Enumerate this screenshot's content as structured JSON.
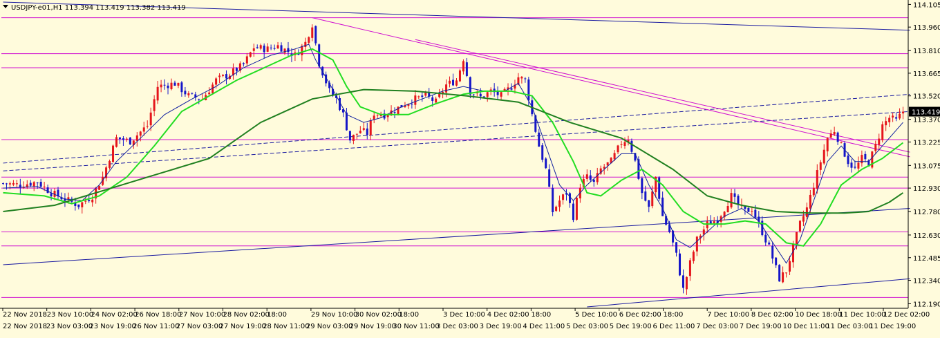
{
  "header": {
    "title": "USDJPY-e01,H1  113.394 113.419 113.382 113.419",
    "menu_icon": "triangle-down-icon"
  },
  "colors": {
    "background": "#fffbdc",
    "bull": "#e5151b",
    "bear": "#1515c8",
    "ma_fast": "#1020a0",
    "ma_mid": "#22dd22",
    "ma_slow": "#208020",
    "level": "#d010d0",
    "channel": "#1a1aa0",
    "price_tag_bg": "#000000",
    "price_tag_fg": "#ffffff"
  },
  "chart_data": {
    "type": "candlestick",
    "symbol": "USDJPY-e01",
    "timeframe": "H1",
    "ylim": [
      112.17,
      114.12
    ],
    "grid": false,
    "current_price": "113.419",
    "y_ticks": [
      "114.105",
      "113.960",
      "113.810",
      "113.665",
      "113.520",
      "113.370",
      "113.225",
      "113.075",
      "112.930",
      "112.780",
      "112.630",
      "112.485",
      "112.340",
      "112.190"
    ],
    "x_ticks_top": [
      "22 Nov 2018",
      "23 Nov 10:00",
      "24 Nov 02:00",
      "26 Nov 18:00",
      "27 Nov 10:00",
      "28 Nov 02:00",
      "18:00",
      "29 Nov 10:00",
      "30 Nov 02:00",
      "18:00",
      "3 Dec 10:00",
      "4 Dec 02:00",
      "18:00",
      "5 Dec 10:00",
      "6 Dec 02:00",
      "18:00",
      "7 Dec 10:00",
      "8 Dec 02:00",
      "10 Dec 18:00",
      "11 Dec 10:00",
      "12 Dec 02:00"
    ],
    "x_ticks_bottom": [
      "22 Nov 2018",
      "23 Nov 03:00",
      "23 Nov 19:00",
      "26 Nov 11:00",
      "27 Nov 03:00",
      "27 Nov 19:00",
      "28 Nov 11:00",
      "29 Nov 03:00",
      "29 Nov 19:00",
      "30 Nov 11:00",
      "3 Dec 03:00",
      "3 Dec 19:00",
      "4 Dec 11:00",
      "5 Dec 03:00",
      "5 Dec 19:00",
      "6 Dec 11:00",
      "7 Dec 03:00",
      "7 Dec 19:00",
      "10 Dec 11:00",
      "11 Dec 03:00",
      "11 Dec 19:00"
    ],
    "horizontal_levels": [
      114.02,
      113.79,
      113.7,
      113.24,
      113.0,
      112.93,
      112.65,
      112.56,
      112.23
    ],
    "close_path": [
      [
        0,
        112.96
      ],
      [
        5,
        112.95
      ],
      [
        10,
        112.97
      ],
      [
        14,
        112.9
      ],
      [
        18,
        112.86
      ],
      [
        22,
        112.82
      ],
      [
        26,
        112.88
      ],
      [
        29,
        113.0
      ],
      [
        33,
        113.25
      ],
      [
        37,
        113.23
      ],
      [
        42,
        113.33
      ],
      [
        45,
        113.58
      ],
      [
        50,
        113.6
      ],
      [
        54,
        113.52
      ],
      [
        58,
        113.5
      ],
      [
        62,
        113.62
      ],
      [
        66,
        113.66
      ],
      [
        70,
        113.72
      ],
      [
        73,
        113.83
      ],
      [
        77,
        113.82
      ],
      [
        80,
        113.84
      ],
      [
        85,
        113.78
      ],
      [
        88,
        113.86
      ],
      [
        90,
        113.98
      ],
      [
        92,
        113.73
      ],
      [
        95,
        113.55
      ],
      [
        97,
        113.5
      ],
      [
        99,
        113.4
      ],
      [
        101,
        113.24
      ],
      [
        104,
        113.3
      ],
      [
        106,
        113.28
      ],
      [
        108,
        113.41
      ],
      [
        111,
        113.4
      ],
      [
        114,
        113.43
      ],
      [
        117,
        113.47
      ],
      [
        120,
        113.5
      ],
      [
        123,
        113.52
      ],
      [
        126,
        113.48
      ],
      [
        129,
        113.59
      ],
      [
        132,
        113.62
      ],
      [
        134,
        113.76
      ],
      [
        136,
        113.55
      ],
      [
        139,
        113.51
      ],
      [
        142,
        113.55
      ],
      [
        145,
        113.52
      ],
      [
        148,
        113.58
      ],
      [
        150,
        113.64
      ],
      [
        152,
        113.62
      ],
      [
        154,
        113.4
      ],
      [
        156,
        113.2
      ],
      [
        158,
        113.05
      ],
      [
        160,
        112.78
      ],
      [
        162,
        112.85
      ],
      [
        164,
        112.9
      ],
      [
        166,
        112.75
      ],
      [
        168,
        112.95
      ],
      [
        170,
        113.0
      ],
      [
        172,
        112.96
      ],
      [
        174,
        113.05
      ],
      [
        177,
        113.1
      ],
      [
        180,
        113.22
      ],
      [
        182,
        113.25
      ],
      [
        184,
        113.1
      ],
      [
        186,
        112.9
      ],
      [
        188,
        112.8
      ],
      [
        190,
        113.0
      ],
      [
        192,
        112.75
      ],
      [
        194,
        112.65
      ],
      [
        196,
        112.5
      ],
      [
        198,
        112.28
      ],
      [
        200,
        112.45
      ],
      [
        202,
        112.6
      ],
      [
        205,
        112.7
      ],
      [
        208,
        112.73
      ],
      [
        210,
        112.8
      ],
      [
        212,
        112.88
      ],
      [
        214,
        112.82
      ],
      [
        216,
        112.78
      ],
      [
        218,
        112.8
      ],
      [
        221,
        112.65
      ],
      [
        223,
        112.55
      ],
      [
        226,
        112.35
      ],
      [
        228,
        112.4
      ],
      [
        230,
        112.55
      ],
      [
        232,
        112.7
      ],
      [
        234,
        112.8
      ],
      [
        236,
        112.95
      ],
      [
        238,
        113.1
      ],
      [
        240,
        113.25
      ],
      [
        242,
        113.3
      ],
      [
        244,
        113.2
      ],
      [
        246,
        113.1
      ],
      [
        248,
        113.05
      ],
      [
        250,
        113.12
      ],
      [
        252,
        113.09
      ],
      [
        254,
        113.2
      ],
      [
        256,
        113.33
      ],
      [
        258,
        113.38
      ],
      [
        260,
        113.36
      ],
      [
        262,
        113.42
      ]
    ],
    "moving_averages": [
      {
        "name": "fast",
        "points": [
          [
            0,
            112.93
          ],
          [
            10,
            112.94
          ],
          [
            18,
            112.86
          ],
          [
            23,
            112.85
          ],
          [
            28,
            112.95
          ],
          [
            33,
            113.1
          ],
          [
            40,
            113.25
          ],
          [
            47,
            113.4
          ],
          [
            55,
            113.5
          ],
          [
            62,
            113.58
          ],
          [
            70,
            113.7
          ],
          [
            78,
            113.78
          ],
          [
            85,
            113.82
          ],
          [
            89,
            113.85
          ],
          [
            91,
            113.75
          ],
          [
            95,
            113.6
          ],
          [
            100,
            113.4
          ],
          [
            105,
            113.35
          ],
          [
            110,
            113.38
          ],
          [
            116,
            113.45
          ],
          [
            122,
            113.5
          ],
          [
            128,
            113.55
          ],
          [
            134,
            113.58
          ],
          [
            140,
            113.55
          ],
          [
            146,
            113.55
          ],
          [
            150,
            113.6
          ],
          [
            154,
            113.45
          ],
          [
            158,
            113.2
          ],
          [
            162,
            112.95
          ],
          [
            166,
            112.85
          ],
          [
            170,
            112.95
          ],
          [
            175,
            113.05
          ],
          [
            180,
            113.15
          ],
          [
            184,
            113.15
          ],
          [
            188,
            112.95
          ],
          [
            192,
            112.8
          ],
          [
            196,
            112.6
          ],
          [
            200,
            112.55
          ],
          [
            205,
            112.65
          ],
          [
            210,
            112.75
          ],
          [
            215,
            112.8
          ],
          [
            220,
            112.72
          ],
          [
            225,
            112.55
          ],
          [
            228,
            112.45
          ],
          [
            232,
            112.6
          ],
          [
            236,
            112.85
          ],
          [
            240,
            113.1
          ],
          [
            244,
            113.2
          ],
          [
            248,
            113.1
          ],
          [
            252,
            113.1
          ],
          [
            256,
            113.2
          ],
          [
            260,
            113.3
          ],
          [
            262,
            113.35
          ]
        ]
      },
      {
        "name": "mid",
        "points": [
          [
            0,
            112.9
          ],
          [
            12,
            112.88
          ],
          [
            20,
            112.83
          ],
          [
            28,
            112.88
          ],
          [
            36,
            113.0
          ],
          [
            44,
            113.2
          ],
          [
            52,
            113.42
          ],
          [
            60,
            113.52
          ],
          [
            68,
            113.62
          ],
          [
            76,
            113.7
          ],
          [
            84,
            113.78
          ],
          [
            90,
            113.82
          ],
          [
            96,
            113.75
          ],
          [
            100,
            113.58
          ],
          [
            104,
            113.45
          ],
          [
            110,
            113.4
          ],
          [
            118,
            113.4
          ],
          [
            126,
            113.47
          ],
          [
            134,
            113.53
          ],
          [
            140,
            113.55
          ],
          [
            148,
            113.55
          ],
          [
            154,
            113.52
          ],
          [
            160,
            113.35
          ],
          [
            166,
            113.1
          ],
          [
            170,
            112.9
          ],
          [
            174,
            112.88
          ],
          [
            180,
            112.98
          ],
          [
            186,
            113.05
          ],
          [
            192,
            112.95
          ],
          [
            198,
            112.78
          ],
          [
            204,
            112.7
          ],
          [
            210,
            112.7
          ],
          [
            216,
            112.72
          ],
          [
            222,
            112.7
          ],
          [
            228,
            112.58
          ],
          [
            233,
            112.56
          ],
          [
            238,
            112.7
          ],
          [
            244,
            112.95
          ],
          [
            250,
            113.05
          ],
          [
            256,
            113.12
          ],
          [
            262,
            113.22
          ]
        ]
      },
      {
        "name": "slow",
        "points": [
          [
            0,
            112.78
          ],
          [
            15,
            112.82
          ],
          [
            30,
            112.92
          ],
          [
            45,
            113.02
          ],
          [
            60,
            113.12
          ],
          [
            75,
            113.35
          ],
          [
            90,
            113.5
          ],
          [
            105,
            113.56
          ],
          [
            120,
            113.55
          ],
          [
            135,
            113.52
          ],
          [
            150,
            113.48
          ],
          [
            165,
            113.35
          ],
          [
            180,
            113.25
          ],
          [
            195,
            113.05
          ],
          [
            205,
            112.88
          ],
          [
            215,
            112.82
          ],
          [
            225,
            112.78
          ],
          [
            235,
            112.77
          ],
          [
            245,
            112.77
          ],
          [
            252,
            112.78
          ],
          [
            258,
            112.84
          ],
          [
            262,
            112.9
          ]
        ]
      }
    ]
  }
}
